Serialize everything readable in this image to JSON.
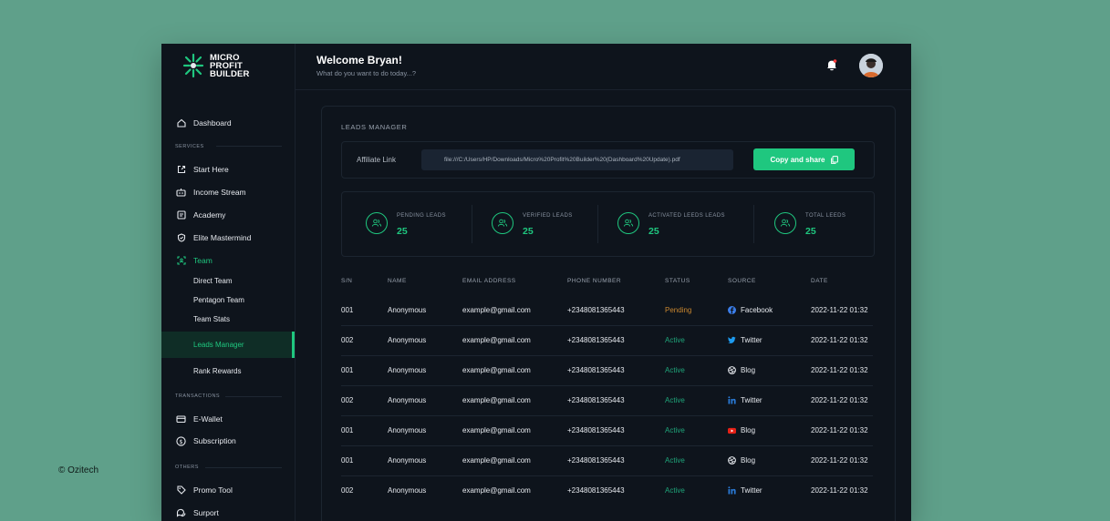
{
  "copyright": "© Ozitech",
  "brand": {
    "line1": "MICRO",
    "line2": "PROFIT",
    "line3": "BUILDER",
    "accent": "#1fc77f"
  },
  "header": {
    "welcome": "Welcome Bryan!",
    "subtitle": "What do you want to do today...?"
  },
  "sidebar": {
    "dashboard": "Dashboard",
    "services_label": "SERVICES",
    "start_here": "Start Here",
    "income_stream": "Income Stream",
    "academy": "Academy",
    "elite_mastermind": "Elite Mastermind",
    "team": "Team",
    "direct_team": "Direct Team",
    "pentagon_team": "Pentagon Team",
    "team_stats": "Team Stats",
    "leads_manager": "Leads Manager",
    "rank_rewards": "Rank Rewards",
    "transactions_label": "TRANSACTIONS",
    "e_wallet": "E-Wallet",
    "subscription": "Subscription",
    "others_label": "OTHERS",
    "promo_tool": "Promo Tool",
    "support": "Surport"
  },
  "main": {
    "title": "LEADS MANAGER",
    "affiliate_label": "Affiliate Link",
    "affiliate_value": "file:///C:/Users/HP/Downloads/Micro%20Profit%20Builder%20(Dashboard%20Update).pdf",
    "copy_button": "Copy and share",
    "stats": [
      {
        "label": "PENDING LEADS",
        "value": "25"
      },
      {
        "label": "VERIFIED LEADS",
        "value": "25"
      },
      {
        "label": "ACTIVATED LEEDS LEADS",
        "value": "25"
      },
      {
        "label": "TOTAL LEEDS",
        "value": "25"
      }
    ],
    "columns": [
      "S/N",
      "NAME",
      "EMAIL ADDRESS",
      "PHONE NUMBER",
      "STATUS",
      "SOURCE",
      "DATE"
    ],
    "rows": [
      {
        "sn": "001",
        "name": "Anonymous",
        "email": "example@gmail.com",
        "phone": "+2348081365443",
        "status": "Pending",
        "source": "Facebook",
        "icon": "facebook-icon",
        "date": "2022-11-22 01:32"
      },
      {
        "sn": "002",
        "name": "Anonymous",
        "email": "example@gmail.com",
        "phone": "+2348081365443",
        "status": "Active",
        "source": "Twitter",
        "icon": "twitter-icon",
        "date": "2022-11-22 01:32"
      },
      {
        "sn": "001",
        "name": "Anonymous",
        "email": "example@gmail.com",
        "phone": "+2348081365443",
        "status": "Active",
        "source": "Blog",
        "icon": "dribbble-icon",
        "date": "2022-11-22 01:32"
      },
      {
        "sn": "002",
        "name": "Anonymous",
        "email": "example@gmail.com",
        "phone": "+2348081365443",
        "status": "Active",
        "source": "Twitter",
        "icon": "linkedin-icon",
        "date": "2022-11-22 01:32"
      },
      {
        "sn": "001",
        "name": "Anonymous",
        "email": "example@gmail.com",
        "phone": "+2348081365443",
        "status": "Active",
        "source": "Blog",
        "icon": "youtube-icon",
        "date": "2022-11-22 01:32"
      },
      {
        "sn": "001",
        "name": "Anonymous",
        "email": "example@gmail.com",
        "phone": "+2348081365443",
        "status": "Active",
        "source": "Blog",
        "icon": "dribbble-icon",
        "date": "2022-11-22 01:32"
      },
      {
        "sn": "002",
        "name": "Anonymous",
        "email": "example@gmail.com",
        "phone": "+2348081365443",
        "status": "Active",
        "source": "Twitter",
        "icon": "linkedin-icon",
        "date": "2022-11-22 01:32"
      }
    ]
  }
}
